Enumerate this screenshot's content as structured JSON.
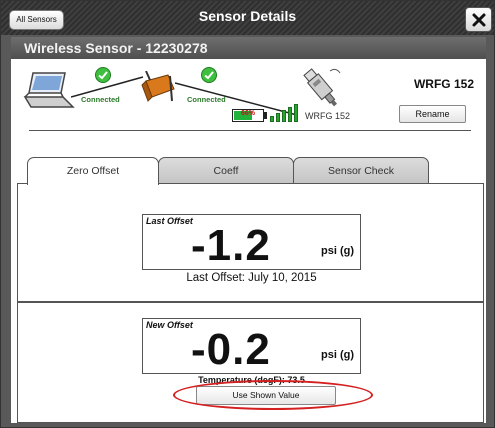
{
  "window": {
    "title": "Sensor Details",
    "all_sensors_label": "All Sensors",
    "close_icon": "close-icon"
  },
  "sensor": {
    "header": "Wireless Sensor - 12230278",
    "name": "WRFG 152",
    "rename_label": "Rename",
    "sensor_label": "WRFG 152",
    "battery_text": "66%",
    "battery_level": 0.66,
    "signal_bars": 5
  },
  "connection": {
    "left_status": "Connected",
    "right_status": "Connected",
    "status_color": "#2d7a2a"
  },
  "tabs": [
    {
      "label": "Zero Offset",
      "active": true
    },
    {
      "label": "Coeff",
      "active": false
    },
    {
      "label": "Sensor Check",
      "active": false
    }
  ],
  "last_offset": {
    "label": "Last Offset",
    "value": "-1.2",
    "unit": "psi (g)",
    "date_text": "Last Offset: July 10, 2015"
  },
  "new_offset": {
    "label": "New Offset",
    "value": "-0.2",
    "unit": "psi (g)",
    "temperature_text": "Temperature (degF): 73.5",
    "use_button_label": "Use Shown Value"
  },
  "colors": {
    "highlight": "#d42020",
    "battery": "#1fb33c",
    "signal": "#29a32f"
  }
}
